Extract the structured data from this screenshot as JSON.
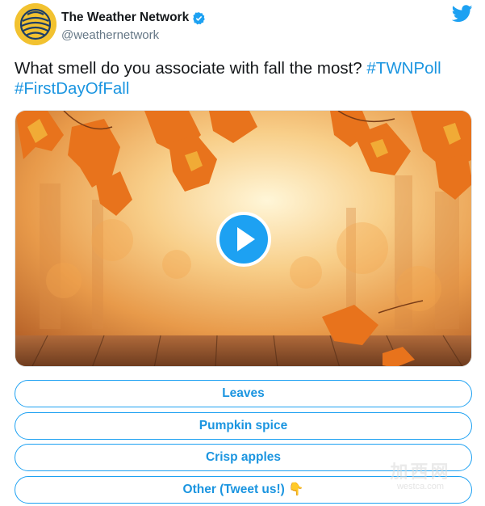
{
  "account": {
    "display_name": "The Weather Network",
    "handle": "@weathernetwork",
    "verified": true,
    "avatar_icon": "weather-network-logo-icon",
    "brand_icon": "twitter-bird-icon"
  },
  "tweet": {
    "text_plain": "What smell do you associate with fall the most? ",
    "hashtag_1": "#TWNPoll",
    "hashtag_2": "#FirstDayOfFall"
  },
  "media": {
    "type": "video",
    "play_icon": "play-icon"
  },
  "poll": {
    "options": [
      {
        "label": "Leaves"
      },
      {
        "label": "Pumpkin spice"
      },
      {
        "label": "Crisp apples"
      },
      {
        "label": "Other (Tweet us!) 👇"
      }
    ]
  },
  "watermark": {
    "cjk": "加西网",
    "url": "westca.com"
  },
  "colors": {
    "link": "#1b95e0",
    "accent": "#1da1f2",
    "text": "#14171a",
    "muted": "#657786"
  }
}
